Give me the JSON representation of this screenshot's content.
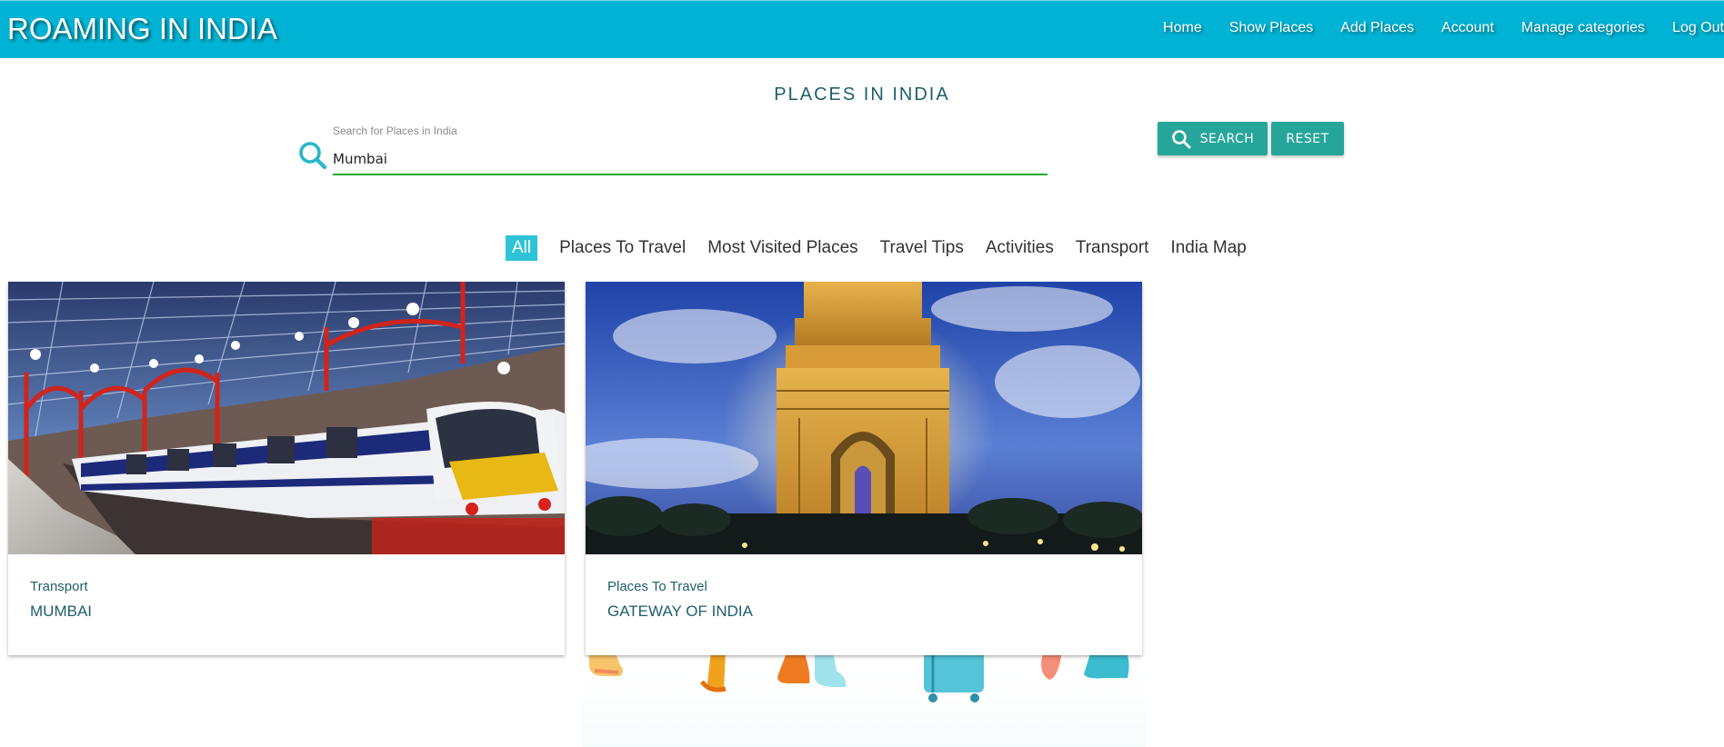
{
  "app": {
    "brand": "ROAMING IN INDIA",
    "accent_color": "#00b3d4",
    "button_color": "#26a69a"
  },
  "nav": {
    "items": [
      {
        "label": "Home"
      },
      {
        "label": "Show Places"
      },
      {
        "label": "Add Places"
      },
      {
        "label": "Account"
      },
      {
        "label": "Manage categories"
      },
      {
        "label": "Log Out"
      }
    ]
  },
  "page": {
    "title": "PLACES IN INDIA"
  },
  "search": {
    "label": "Search for Places in India",
    "value": "Mumbai",
    "icon": "search-icon",
    "search_button": "SEARCH",
    "reset_button": "RESET"
  },
  "tabs": {
    "items": [
      {
        "label": "All",
        "active": true
      },
      {
        "label": "Places To Travel"
      },
      {
        "label": "Most Visited Places"
      },
      {
        "label": "Travel Tips"
      },
      {
        "label": "Activities"
      },
      {
        "label": "Transport"
      },
      {
        "label": "India Map"
      }
    ]
  },
  "cards": [
    {
      "category": "Transport",
      "title": "MUMBAI",
      "image": "train-station-photo"
    },
    {
      "category": "Places To Travel",
      "title": "GATEWAY OF INDIA",
      "image": "india-gate-photo"
    }
  ]
}
